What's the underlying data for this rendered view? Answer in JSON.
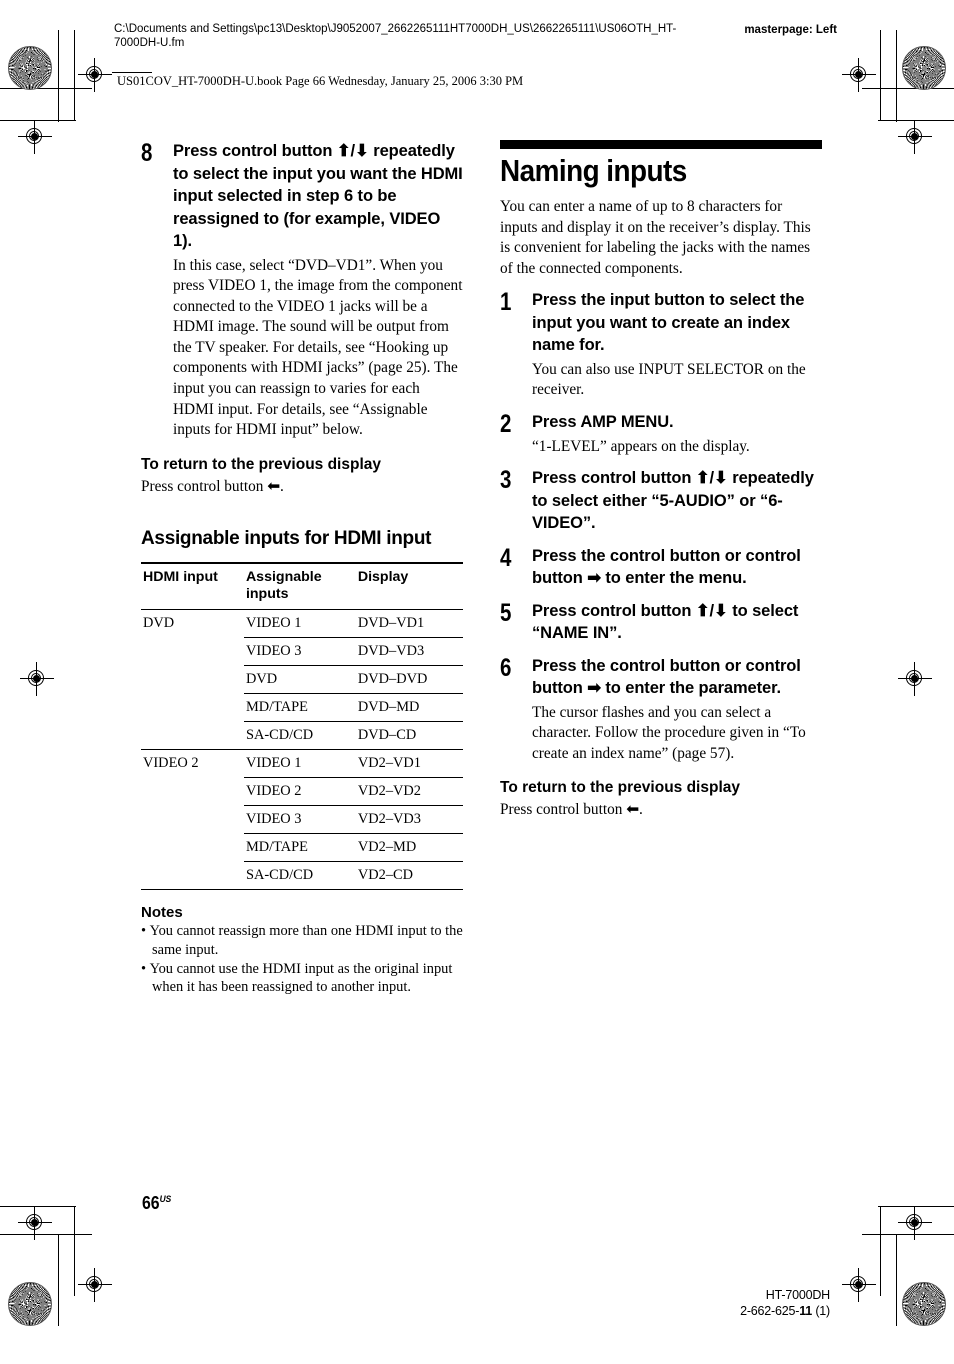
{
  "header": {
    "job_path": "C:\\Documents and Settings\\pc13\\Desktop\\J9052007_2662265111HT7000DH_US\\2662265111\\US06OTH_HT-7000DH-U.fm",
    "masterpage": "masterpage: Left",
    "book_line": "US01COV_HT-7000DH-U.book  Page 66  Wednesday, January 25, 2006  3:30 PM"
  },
  "left_column": {
    "step8": {
      "number": "8",
      "title": "Press control button ⬆/⬇ repeatedly to select the input you want the HDMI input selected in step 6 to be reassigned to (for example, VIDEO 1).",
      "note": "In this case, select “DVD–VD1”. When you press VIDEO 1, the image from the component connected to the VIDEO 1 jacks will be a HDMI image. The sound will be output from the TV speaker. For details, see “Hooking up components with HDMI jacks” (page 25). The input you can reassign to varies for each HDMI input. For details, see “Assignable inputs for HDMI input” below."
    },
    "return_heading": "To return to the previous display",
    "return_text": "Press control button ⬅.",
    "section_heading": "Assignable inputs for HDMI input",
    "table": {
      "columns": [
        "HDMI input",
        "Assignable inputs",
        "Display"
      ],
      "rows": [
        {
          "hdmi": "DVD",
          "assignable": "VIDEO 1",
          "display": "DVD–VD1",
          "group_start": true
        },
        {
          "hdmi": "",
          "assignable": "VIDEO 3",
          "display": "DVD–VD3",
          "group_start": false
        },
        {
          "hdmi": "",
          "assignable": "DVD",
          "display": "DVD–DVD",
          "group_start": false
        },
        {
          "hdmi": "",
          "assignable": "MD/TAPE",
          "display": "DVD–MD",
          "group_start": false
        },
        {
          "hdmi": "",
          "assignable": "SA-CD/CD",
          "display": "DVD–CD",
          "group_start": false
        },
        {
          "hdmi": "VIDEO 2",
          "assignable": "VIDEO 1",
          "display": "VD2–VD1",
          "group_start": true
        },
        {
          "hdmi": "",
          "assignable": "VIDEO 2",
          "display": "VD2–VD2",
          "group_start": false
        },
        {
          "hdmi": "",
          "assignable": "VIDEO 3",
          "display": "VD2–VD3",
          "group_start": false
        },
        {
          "hdmi": "",
          "assignable": "MD/TAPE",
          "display": "VD2–MD",
          "group_start": false
        },
        {
          "hdmi": "",
          "assignable": "SA-CD/CD",
          "display": "VD2–CD",
          "group_start": false
        }
      ]
    },
    "notes_heading": "Notes",
    "notes": [
      "You cannot reassign more than one HDMI input to the same input.",
      "You cannot use the HDMI input as the original input when it has been reassigned to another input."
    ]
  },
  "right_column": {
    "chapter_title": "Naming inputs",
    "intro": "You can enter a name of up to 8 characters for inputs and display it on the receiver’s display. This is convenient for labeling the jacks with the names of the connected components.",
    "steps": [
      {
        "number": "1",
        "title": "Press the input button to select the input you want to create an index name for.",
        "note": "You can also use INPUT SELECTOR on the receiver."
      },
      {
        "number": "2",
        "title": "Press AMP MENU.",
        "note": "“1-LEVEL” appears on the display."
      },
      {
        "number": "3",
        "title": "Press control button ⬆/⬇ repeatedly to select either “5-AUDIO” or “6-VIDEO”.",
        "note": ""
      },
      {
        "number": "4",
        "title": "Press the control button or control button ➡ to enter the menu.",
        "note": ""
      },
      {
        "number": "5",
        "title": "Press control button ⬆/⬇ to select “NAME IN”.",
        "note": ""
      },
      {
        "number": "6",
        "title": "Press the control button or control button ➡ to enter the parameter.",
        "note": "The cursor flashes and you can select a character. Follow the procedure given in “To create an index name” (page 57)."
      }
    ],
    "return_heading": "To return to the previous display",
    "return_text": "Press control button ⬅."
  },
  "footer": {
    "page_number": "66",
    "page_suffix": "US",
    "model": "HT-7000DH",
    "part_prefix": "2-662-625-",
    "part_bold": "11",
    "part_suffix": " (1)"
  }
}
